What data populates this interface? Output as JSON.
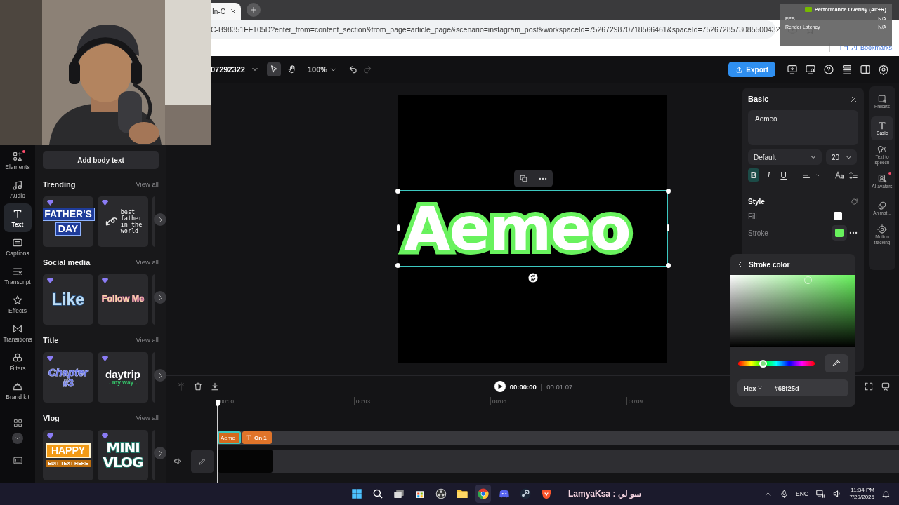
{
  "browser": {
    "tab_title": "In-C",
    "address": "C-B98351FF105D?enter_from=content_section&from_page=article_page&scenario=instagram_post&workspaceId=7526729870718566461&spaceId=7526728573085500432",
    "bookmarks": "All Bookmarks"
  },
  "perf_overlay": {
    "title": "Performance Overlay (Alt+R)",
    "metrics": [
      {
        "label": "FPS",
        "value": "N/A"
      },
      {
        "label": "Render Latency",
        "value": "N/A"
      }
    ]
  },
  "header": {
    "project": "07292322",
    "tools": [
      {
        "kind": "select",
        "selected": true
      },
      {
        "kind": "hand",
        "selected": false
      }
    ],
    "zoom": "100%",
    "redo_disabled": true,
    "export": "Export"
  },
  "rail": [
    {
      "label": "Elements",
      "kind": "elements",
      "selected": false,
      "badge": true
    },
    {
      "label": "Audio",
      "kind": "audio",
      "selected": false,
      "badge": false
    },
    {
      "label": "Text",
      "kind": "text",
      "selected": true,
      "badge": false
    },
    {
      "label": "Captions",
      "kind": "captions",
      "selected": false,
      "badge": false
    },
    {
      "label": "Transcript",
      "kind": "transcript",
      "selected": false,
      "badge": false
    },
    {
      "label": "Effects",
      "kind": "effects",
      "selected": false,
      "badge": false
    },
    {
      "label": "Transitions",
      "kind": "transitions",
      "selected": false,
      "badge": false
    },
    {
      "label": "Filters",
      "kind": "filters",
      "selected": false,
      "badge": false
    },
    {
      "label": "Brand kit",
      "kind": "brand",
      "selected": false,
      "badge": false
    }
  ],
  "panel": {
    "add_button": "Add body text",
    "sections": [
      {
        "title": "Trending",
        "view_all": "View all",
        "templates": [
          {
            "kind": "block",
            "lines": [
              "FATHER'S",
              "DAY"
            ]
          },
          {
            "kind": "handwritten",
            "lines": [
              "best",
              "father",
              "in the",
              "world"
            ]
          }
        ]
      },
      {
        "title": "Social media",
        "view_all": "View all",
        "templates": [
          {
            "kind": "outlined",
            "lines": [
              "Like"
            ]
          },
          {
            "kind": "pastel",
            "lines": [
              "Follow Me"
            ]
          }
        ]
      },
      {
        "title": "Title",
        "view_all": "View all",
        "templates": [
          {
            "kind": "chapter",
            "lines": [
              "Chapter",
              "#3"
            ]
          },
          {
            "kind": "daytrip",
            "lines": [
              "daytrip",
              ". my way ."
            ]
          }
        ]
      },
      {
        "title": "Vlog",
        "view_all": "View all",
        "templates": [
          {
            "kind": "badge",
            "lines": [
              "HAPPY",
              "EDIT TEXT HERE"
            ]
          },
          {
            "kind": "stacked",
            "lines": [
              "MINI",
              "VLOG"
            ]
          }
        ]
      }
    ]
  },
  "canvas": {
    "text": "Aemeo",
    "selected": true
  },
  "properties": {
    "title": "Basic",
    "text": "Aemeo",
    "font": "Default",
    "size": "20",
    "format": [
      {
        "kind": "bold",
        "label": "B",
        "selected": true
      },
      {
        "kind": "italic",
        "label": "I",
        "selected": false
      },
      {
        "kind": "underline",
        "label": "U",
        "selected": false
      }
    ],
    "style_title": "Style",
    "rows": [
      {
        "label": "Fill",
        "color": "#ffffff",
        "selected": false
      },
      {
        "label": "Stroke",
        "color": "#68f25d",
        "selected": true
      }
    ]
  },
  "color_popup": {
    "title": "Stroke color",
    "hue_slider": {
      "level": 0.32
    },
    "format": "Hex",
    "value": "#68f25d"
  },
  "side_rail": [
    {
      "label": "Presets",
      "kind": "presets",
      "selected": false,
      "badge": false
    },
    {
      "label": "Basic",
      "kind": "text",
      "selected": true,
      "badge": false
    },
    {
      "label": "Text to speech",
      "kind": "speech",
      "selected": false,
      "badge": false
    },
    {
      "label": "AI avatars",
      "kind": "avatar",
      "selected": false,
      "badge": true
    },
    {
      "label": "Animat...",
      "kind": "animation",
      "selected": false,
      "badge": false
    },
    {
      "label": "Motion tracking",
      "kind": "tracking",
      "selected": false,
      "badge": false
    }
  ],
  "timeline": {
    "split_disabled": true,
    "current": "00:00:00",
    "separator": "|",
    "duration": "00:01:07",
    "ticks": [
      "00:00",
      "00:03",
      "00:06",
      "00:09"
    ],
    "clips": [
      {
        "kind": "text",
        "label": "Aeme",
        "selected": true
      },
      {
        "kind": "effect",
        "label": "On 1",
        "selected": false
      }
    ]
  },
  "taskbar": {
    "apps": [
      {
        "kind": "windows",
        "active": false
      },
      {
        "kind": "search",
        "active": false
      },
      {
        "kind": "taskview",
        "active": false
      },
      {
        "kind": "store",
        "active": false
      },
      {
        "kind": "recorder",
        "active": false
      },
      {
        "kind": "folder",
        "active": false
      },
      {
        "kind": "browser",
        "active": true
      },
      {
        "kind": "chat",
        "active": false
      },
      {
        "kind": "steam",
        "active": false
      },
      {
        "kind": "lion",
        "active": false
      }
    ],
    "message": "سو لي : LamyaKsa",
    "language": "ENG",
    "time": "11:34 PM",
    "date": "7/29/2025"
  }
}
